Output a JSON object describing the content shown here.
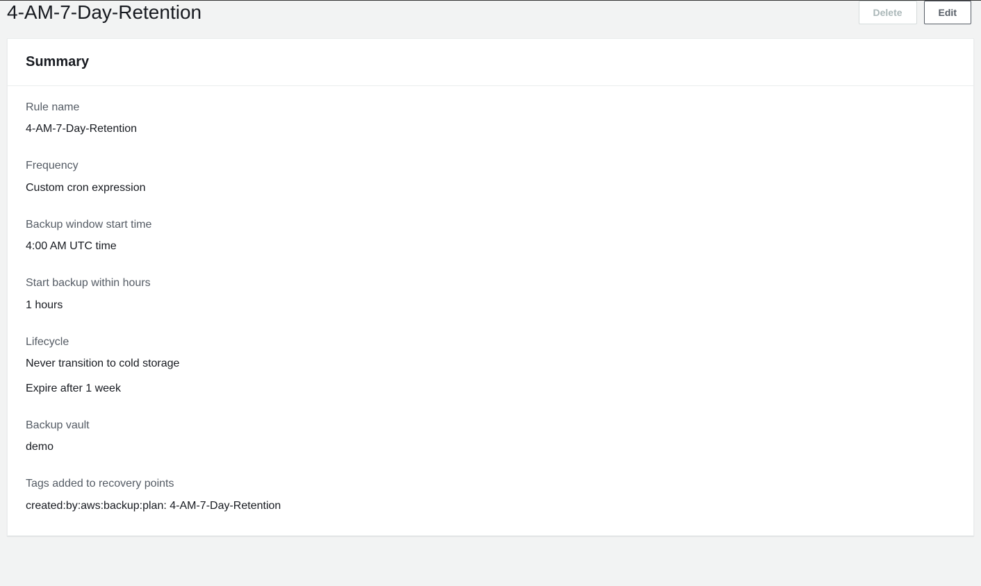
{
  "header": {
    "title": "4-AM-7-Day-Retention",
    "delete_label": "Delete",
    "edit_label": "Edit"
  },
  "summary": {
    "panel_title": "Summary",
    "fields": {
      "rule_name": {
        "label": "Rule name",
        "value": "4-AM-7-Day-Retention"
      },
      "frequency": {
        "label": "Frequency",
        "value": "Custom cron expression"
      },
      "backup_window": {
        "label": "Backup window start time",
        "value": "4:00 AM UTC time"
      },
      "start_within": {
        "label": "Start backup within hours",
        "value": "1 hours"
      },
      "lifecycle": {
        "label": "Lifecycle",
        "value1": "Never transition to cold storage",
        "value2": "Expire after 1 week"
      },
      "backup_vault": {
        "label": "Backup vault",
        "value": "demo"
      },
      "tags": {
        "label": "Tags added to recovery points",
        "value": "created:by:aws:backup:plan: 4-AM-7-Day-Retention"
      }
    }
  }
}
